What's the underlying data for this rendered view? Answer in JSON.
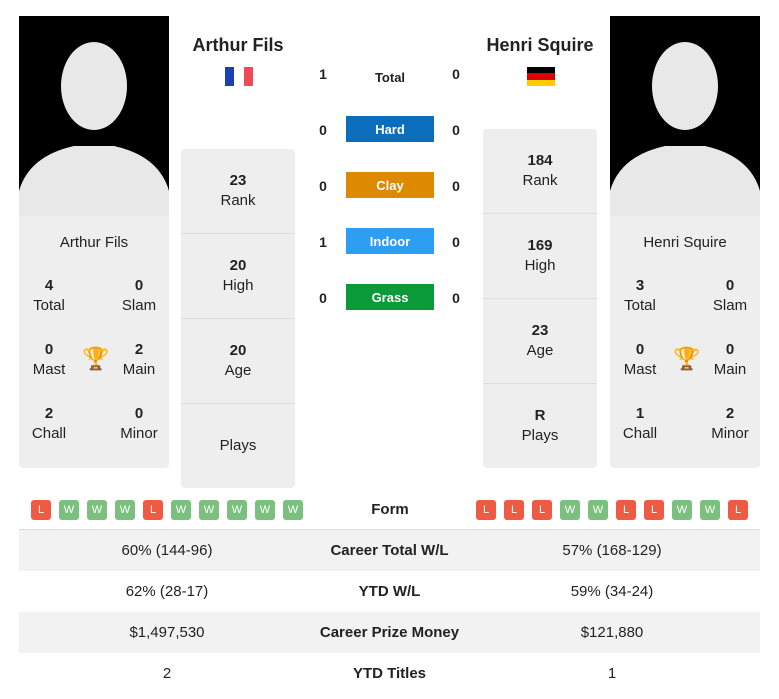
{
  "p1": {
    "name": "Arthur Fils",
    "flag": "France",
    "stats": {
      "total": "4",
      "slam": "0",
      "mast": "0",
      "main": "2",
      "chall": "2",
      "minor": "0"
    },
    "labels": {
      "total": "Total",
      "slam": "Slam",
      "mast": "Mast",
      "main": "Main",
      "chall": "Chall",
      "minor": "Minor"
    },
    "rank": "23",
    "high": "20",
    "age": "20",
    "plays": ""
  },
  "p2": {
    "name": "Henri Squire",
    "flag": "Germany",
    "stats": {
      "total": "3",
      "slam": "0",
      "mast": "0",
      "main": "0",
      "chall": "1",
      "minor": "2"
    },
    "rank": "184",
    "high": "169",
    "age": "23",
    "plays": "R"
  },
  "mid_labels": {
    "rank": "Rank",
    "high": "High",
    "age": "Age",
    "plays": "Plays"
  },
  "h2h": [
    {
      "label": "Total",
      "p1": "1",
      "p2": "0"
    },
    {
      "label": "Hard",
      "p1": "0",
      "p2": "0",
      "color": "#0a6ebd"
    },
    {
      "label": "Clay",
      "p1": "0",
      "p2": "0",
      "color": "#dd8a00"
    },
    {
      "label": "Indoor",
      "p1": "1",
      "p2": "0",
      "color": "#2e9ef2"
    },
    {
      "label": "Grass",
      "p1": "0",
      "p2": "0",
      "color": "#0a9a3a"
    }
  ],
  "form": {
    "label": "Form",
    "p1": [
      "L",
      "W",
      "W",
      "W",
      "L",
      "W",
      "W",
      "W",
      "W",
      "W"
    ],
    "p2": [
      "L",
      "L",
      "L",
      "W",
      "W",
      "L",
      "L",
      "W",
      "W",
      "L"
    ],
    "colors": {
      "W": "#7cc07f",
      "L": "#ee5b43"
    }
  },
  "rows": [
    {
      "label": "Career Total W/L",
      "p1": "60% (144-96)",
      "p2": "57% (168-129)"
    },
    {
      "label": "YTD W/L",
      "p1": "62% (28-17)",
      "p2": "59% (34-24)"
    },
    {
      "label": "Career Prize Money",
      "p1": "$1,497,530",
      "p2": "$121,880"
    },
    {
      "label": "YTD Titles",
      "p1": "2",
      "p2": "1"
    }
  ]
}
